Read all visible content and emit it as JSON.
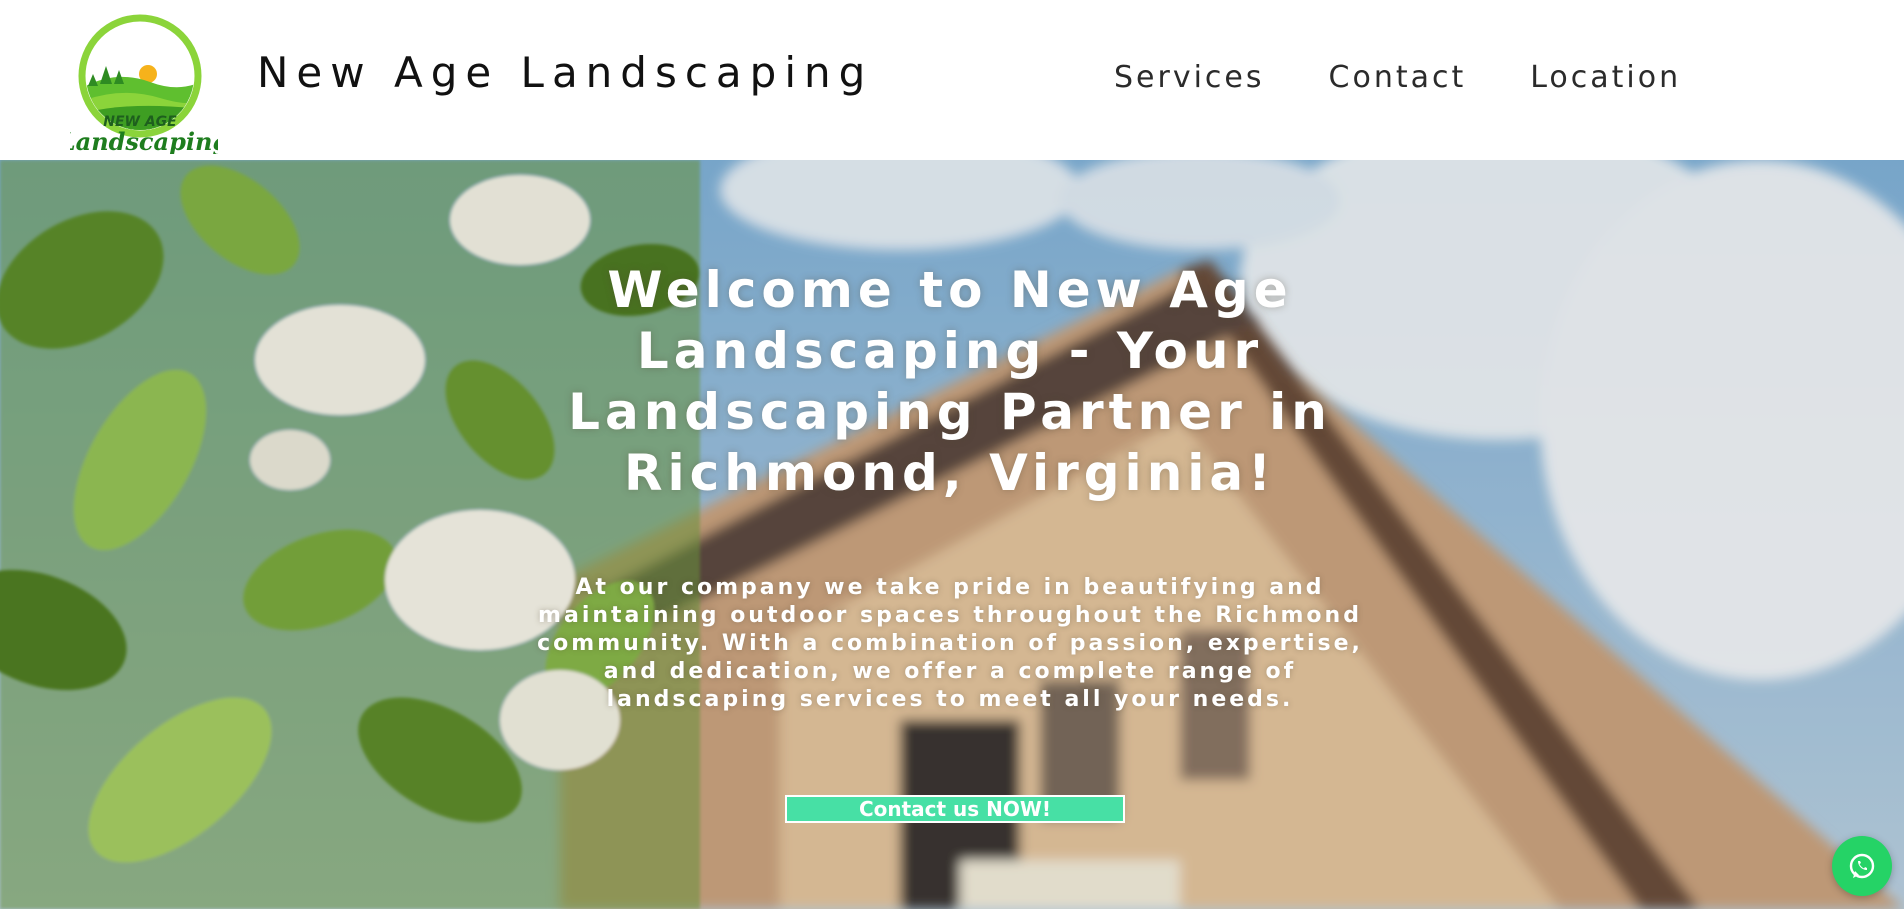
{
  "header": {
    "logo": {
      "line1": "NEW AGE",
      "line2": "Landscaping"
    },
    "site_title": "New Age Landscaping",
    "nav": [
      {
        "label": "Services"
      },
      {
        "label": "Contact"
      },
      {
        "label": "Location"
      }
    ]
  },
  "hero": {
    "title": "Welcome to New Age Landscaping - Your Landscaping Partner in Richmond, Virginia!",
    "text": "At our company we take pride in beautifying and maintaining outdoor spaces throughout the Richmond community. With a combination of passion, expertise, and dedication, we offer a complete range of landscaping services to meet all your needs.",
    "cta_label": "Contact us NOW!"
  },
  "floating": {
    "whatsapp_icon": "whatsapp-icon"
  },
  "colors": {
    "accent": "#47e0a5",
    "logo_green": "#1e7d1e",
    "logo_light_green": "#8bd43a",
    "whatsapp": "#25d366"
  }
}
